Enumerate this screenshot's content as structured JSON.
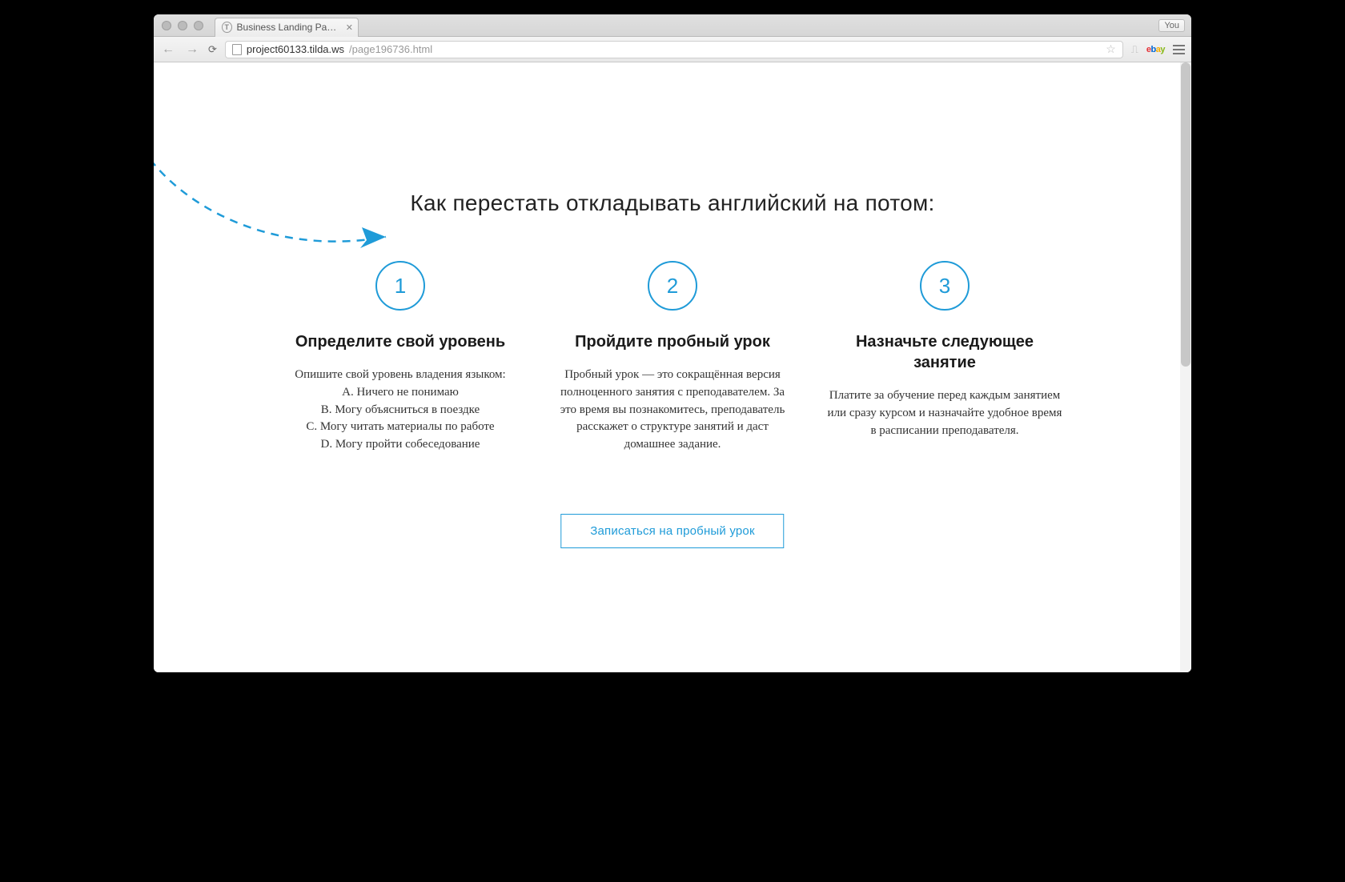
{
  "browser": {
    "tab_title": "Business Landing Page: En",
    "url_host": "project60133.tilda.ws",
    "url_path": "/page196736.html",
    "you_label": "You"
  },
  "page": {
    "heading": "Как перестать откладывать английский на потом:",
    "steps": [
      {
        "num": "1",
        "title": "Определите свой уровень",
        "desc": "Опишите свой уровень владения языком:\nA. Ничего не понимаю\nB. Могу объясниться в поездке\nC. Могу читать материалы по работе\nD. Могу пройти собеседование"
      },
      {
        "num": "2",
        "title": "Пройдите пробный урок",
        "desc": "Пробный урок — это сокращённая версия полноценного занятия с преподавателем. За это время вы познакомитесь, преподаватель расскажет о структуре занятий и даст домашнее задание."
      },
      {
        "num": "3",
        "title": "Назначьте следующее занятие",
        "desc": "Платите за обучение перед каждым занятием или сразу курсом и назначайте удобное время в расписании преподавателя."
      }
    ],
    "cta_label": "Записаться на пробный урок"
  }
}
